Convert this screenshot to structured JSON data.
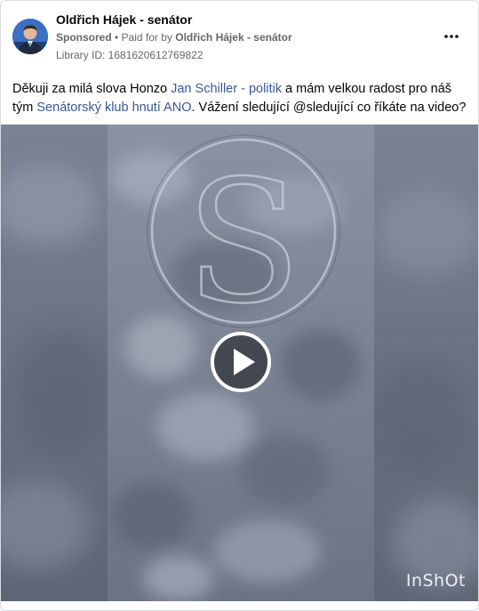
{
  "post": {
    "page_name": "Oldřich Hájek - senátor",
    "sponsored_label": "Sponsored",
    "separator": " • ",
    "paid_for_prefix": "Paid for by ",
    "payer": "Oldřich Hájek - senátor",
    "library_id": "Library ID: 1681620612769822",
    "more_icon": "more-horizontal-icon",
    "text": {
      "part1": "Děkuji za milá slova Honzo ",
      "link1": "Jan Schiller - politik",
      "part2": " a mám velkou radost pro náš tým ",
      "link2": "Senátorský klub hnutí ANO",
      "part3": ". Vážení sledující @sledující co říkáte na video?"
    }
  },
  "video": {
    "play_icon": "play-icon",
    "logo_letter": "S",
    "watermark": "InShOt"
  },
  "colors": {
    "link": "#385898",
    "secondary_text": "#65676b",
    "video_bg": "#6e7686"
  }
}
